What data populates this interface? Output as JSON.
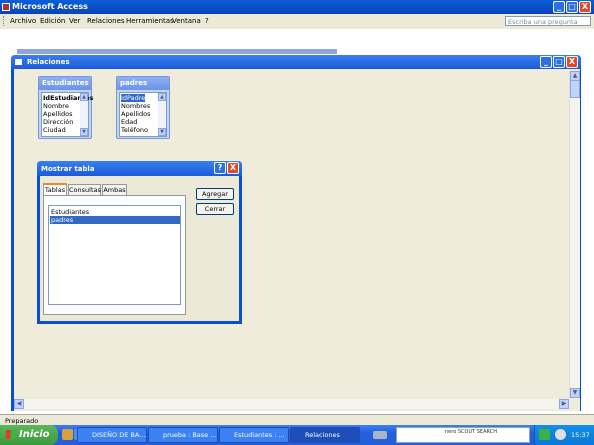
{
  "app": {
    "title": "Microsoft Access",
    "min": "_",
    "max": "□",
    "close": "X"
  },
  "menu": {
    "items": [
      "Archivo",
      "Edición",
      "Ver",
      "Relaciones",
      "Herramientas",
      "Ventana",
      "?"
    ],
    "ask_placeholder": "Escriba una pregunta"
  },
  "relaciones": {
    "title": "Relaciones",
    "tables": [
      {
        "name": "Estudiantes",
        "fields": [
          "IdEstudiantes",
          "Nombre",
          "Apellidos",
          "Dirección",
          "Ciudad"
        ]
      },
      {
        "name": "padres",
        "fields": [
          "IdPadre",
          "Nombres",
          "Apellidos",
          "Edad",
          "Teléfono"
        ]
      }
    ]
  },
  "dialog": {
    "title": "Mostrar tabla",
    "help": "?",
    "close": "X",
    "tabs": [
      "Tablas",
      "Consultas",
      "Ambas"
    ],
    "list": [
      "Estudiantes",
      "padres"
    ],
    "add": "Agregar",
    "close_btn": "Cerrar"
  },
  "status": "Preparado",
  "taskbar": {
    "start": "Inicio",
    "tasks": [
      "DISEÑO DE BA...",
      "prueba : Base ...",
      "Estudiantes : ...",
      "Relaciones"
    ],
    "nero": "nero SCOUT SEARCH",
    "clock": "15:37"
  }
}
